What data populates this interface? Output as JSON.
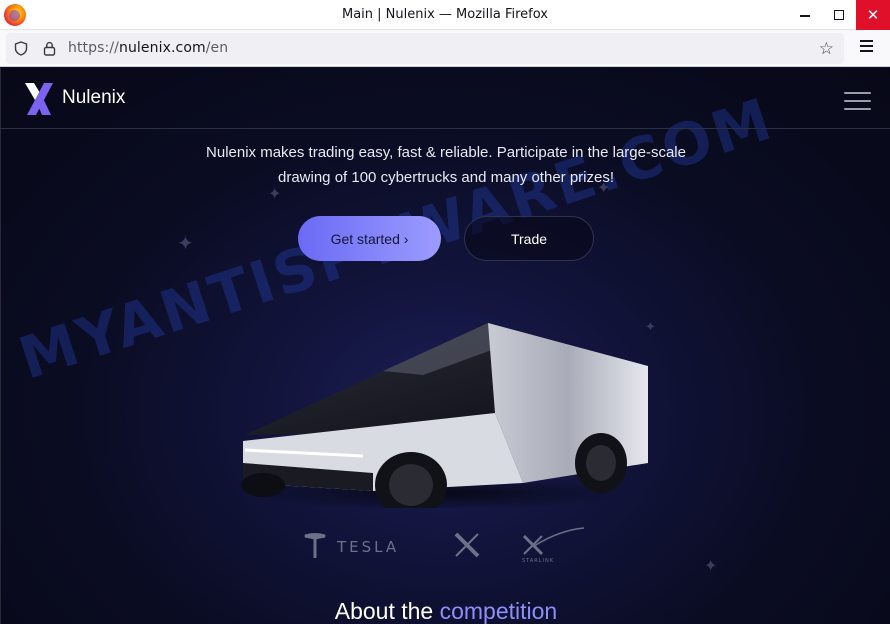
{
  "window": {
    "title": "Main | Nulenix — Mozilla Firefox",
    "minimize_glyph": "",
    "close_glyph": "✕"
  },
  "toolbar": {
    "url_scheme": "https://",
    "url_host": "nulenix.com",
    "url_path": "/en",
    "bookmark_glyph": "☆"
  },
  "site": {
    "brand": "Nulenix",
    "tagline_line1": "Nulenix makes trading easy, fast & reliable. Participate in the large-scale",
    "tagline_line2": "drawing of 100 cybertrucks and many other prizes!",
    "cta_primary": "Get started ›",
    "cta_secondary": "Trade",
    "about_prefix": "About the",
    "about_accent": "competition",
    "partners": [
      "tesla-logo",
      "x-logo",
      "starlink-logo"
    ],
    "accent_color": "#8e8ef8",
    "button_gradient": [
      "#6a6af5",
      "#9c9cff"
    ]
  },
  "overlay": {
    "watermark": "MYANTISPYWARE.COM"
  }
}
